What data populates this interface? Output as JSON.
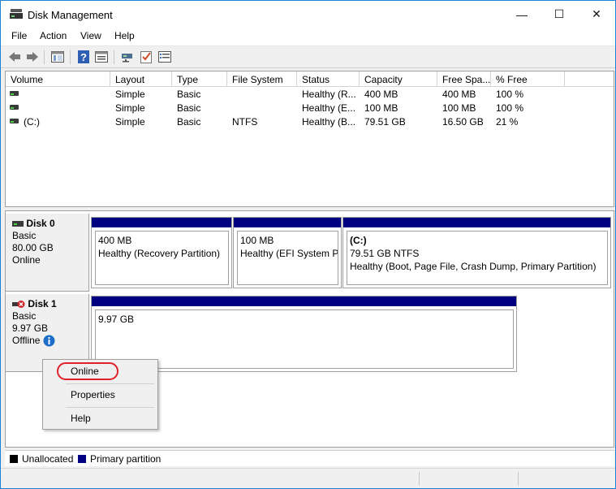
{
  "window": {
    "title": "Disk Management",
    "minimize": "—",
    "maximize": "☐",
    "close": "✕"
  },
  "menu": [
    "File",
    "Action",
    "View",
    "Help"
  ],
  "volume_list": {
    "columns": [
      "Volume",
      "Layout",
      "Type",
      "File System",
      "Status",
      "Capacity",
      "Free Spa...",
      "% Free"
    ],
    "rows": [
      {
        "volume": "",
        "layout": "Simple",
        "type": "Basic",
        "fs": "",
        "status": "Healthy (R...",
        "capacity": "400 MB",
        "free": "400 MB",
        "pct": "100 %"
      },
      {
        "volume": "",
        "layout": "Simple",
        "type": "Basic",
        "fs": "",
        "status": "Healthy (E...",
        "capacity": "100 MB",
        "free": "100 MB",
        "pct": "100 %"
      },
      {
        "volume": "(C:)",
        "layout": "Simple",
        "type": "Basic",
        "fs": "NTFS",
        "status": "Healthy (B...",
        "capacity": "79.51 GB",
        "free": "16.50 GB",
        "pct": "21 %"
      }
    ]
  },
  "disks": [
    {
      "name": "Disk 0",
      "kind": "Basic",
      "size": "80.00 GB",
      "state": "Online",
      "partitions": [
        {
          "label": "",
          "size": "400 MB",
          "status": "Healthy (Recovery Partition)"
        },
        {
          "label": "",
          "size": "100 MB",
          "status": "Healthy (EFI System Pa"
        },
        {
          "label": "(C:)",
          "size": "79.51 GB NTFS",
          "status": "Healthy (Boot, Page File, Crash Dump, Primary Partition)"
        }
      ]
    },
    {
      "name": "Disk 1",
      "kind": "Basic",
      "size": "9.97 GB",
      "state": "Offline",
      "partitions": [
        {
          "label": "",
          "size": "9.97 GB",
          "status": ""
        }
      ]
    }
  ],
  "context_menu": {
    "items": [
      "Online",
      "Properties",
      "Help"
    ]
  },
  "legend": [
    {
      "label": "Unallocated",
      "color": "#000000"
    },
    {
      "label": "Primary partition",
      "color": "#000080"
    }
  ],
  "colors": {
    "partition_bar": "#000080",
    "highlight_ring": "#e0202a",
    "info_icon": "#1c6fc8"
  },
  "icons": {
    "toolbar": [
      "back-arrow-icon",
      "forward-arrow-icon",
      "show-hide-tree-icon",
      "help-icon",
      "properties-icon",
      "connect-icon",
      "checklist-icon",
      "list-view-icon"
    ]
  }
}
